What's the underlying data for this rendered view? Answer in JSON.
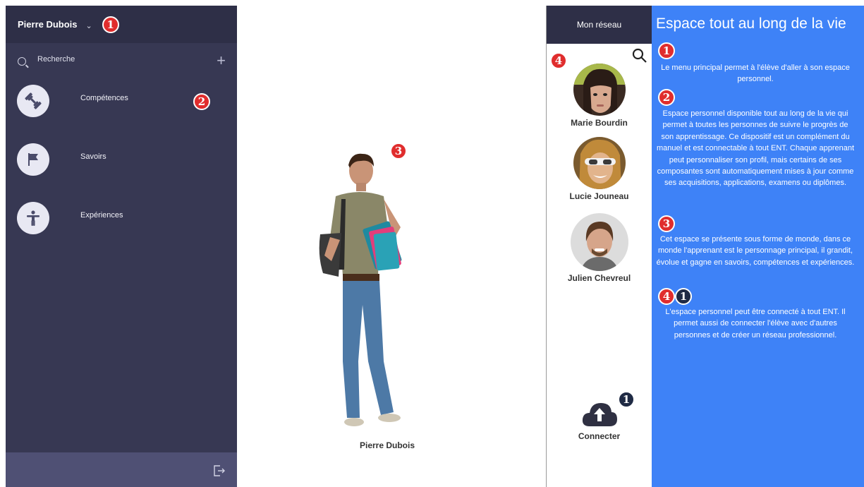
{
  "sidebar": {
    "user_name": "Pierre Dubois",
    "search_label": "Recherche",
    "items": [
      {
        "label": "Compétences",
        "icon": "dumbbell-icon"
      },
      {
        "label": "Savoirs",
        "icon": "flag-icon"
      },
      {
        "label": "Expériences",
        "icon": "accessibility-person-icon"
      }
    ],
    "footer_icon": "logout-icon"
  },
  "center": {
    "avatar_name": "Pierre Dubois"
  },
  "badges": {
    "b1": "1",
    "b2": "2",
    "b3": "3",
    "b4": "4"
  },
  "network": {
    "title": "Mon réseau",
    "contacts": [
      {
        "name": "Marie Bourdin"
      },
      {
        "name": "Lucie Jouneau"
      },
      {
        "name": "Julien Chevreul"
      }
    ],
    "connect_label": "Connecter"
  },
  "info": {
    "title": "Espace tout au long de la vie",
    "blocks": [
      {
        "text": "Le menu principal permet à l'élève d'aller à son espace personnel."
      },
      {
        "text": "Espace personnel disponible tout au long de la vie qui permet à toutes les personnes de suivre le progrès de son apprentissage. Ce dispositif est un complément du manuel et est connectable à tout ENT. Chaque apprenant peut personnaliser son profil, mais certains de ses composantes sont automatiquement mises à jour comme ses acquisitions, applications, examens ou diplômes."
      },
      {
        "text": "Cet espace se présente sous forme de monde, dans ce monde l'apprenant est le personnage principal, il grandit, évolue et gagne en savoirs, compétences et expériences."
      },
      {
        "text": "L'espace personnel peut être connecté à tout ENT. Il permet aussi de connecter l'élève avec d'autres personnes et de créer un réseau professionnel."
      }
    ]
  },
  "colors": {
    "sidebar_bg": "#373853",
    "header_bg": "#2e2f47",
    "info_bg": "#3e82f7",
    "badge_red": "#e02d2d",
    "badge_dark": "#1f2a44"
  }
}
